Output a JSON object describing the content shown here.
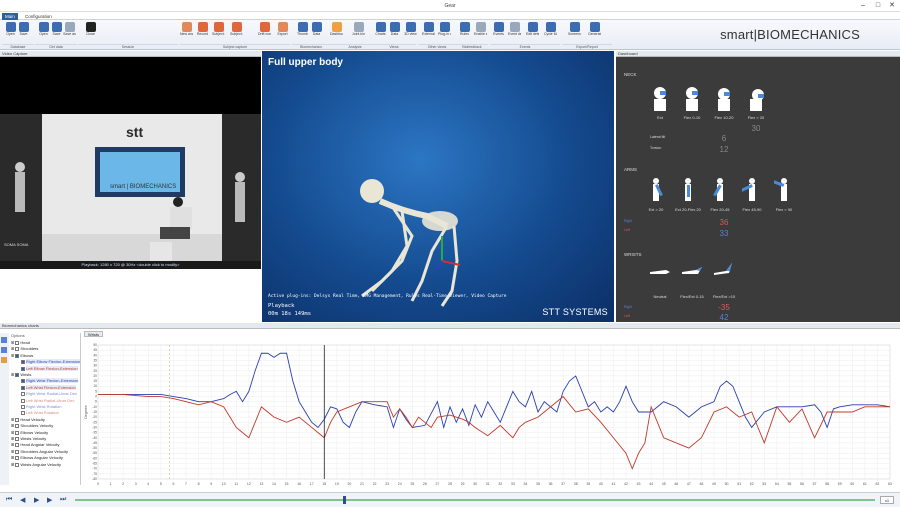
{
  "window": {
    "title": "Gear",
    "controls": [
      "–",
      "□",
      "✕"
    ]
  },
  "tabs": [
    {
      "label": "Main",
      "active": true
    },
    {
      "label": "Configuration",
      "active": false
    }
  ],
  "ribbon": {
    "buttons": [
      {
        "label": "Open",
        "icon": "folder-icon",
        "color": "#3b6db0"
      },
      {
        "label": "Save",
        "icon": "save-icon",
        "color": "#3b6db0"
      },
      {
        "label": "Open",
        "icon": "open-file-icon",
        "color": "#3b6db0"
      },
      {
        "label": "Save",
        "icon": "save-file-icon",
        "color": "#3b6db0"
      },
      {
        "label": "Save as",
        "icon": "save-as-icon",
        "color": "#9aa8bb"
      },
      {
        "label": "Close",
        "icon": "close-icon",
        "color": "#222222"
      },
      {
        "label": "New analysis",
        "icon": "new-analysis-icon",
        "color": "#e08a5c"
      },
      {
        "label": "Record",
        "icon": "record-icon",
        "color": "#e0673c"
      },
      {
        "label": "Subject on (standard)",
        "icon": "subject-standard-icon",
        "color": "#e0673c"
      },
      {
        "label": "Subject on ground (alt)",
        "icon": "subject-ground-icon",
        "color": "#e0673c"
      },
      {
        "label": "Drift correction",
        "icon": "drift-icon",
        "color": "#e0673c"
      },
      {
        "label": "Export",
        "icon": "export-icon",
        "color": "#e08a5c"
      },
      {
        "label": "Thumb",
        "icon": "thumb-icon",
        "color": "#3b6db0"
      },
      {
        "label": "Data",
        "icon": "data-icon",
        "color": "#3b6db0"
      },
      {
        "label": "Dashboard",
        "icon": "dashboard-icon",
        "color": "#f0a040"
      },
      {
        "label": "Joint kinematics",
        "icon": "joint-icon",
        "color": "#9aa8bb"
      },
      {
        "label": "Charts",
        "icon": "charts-icon",
        "color": "#3b6db0"
      },
      {
        "label": "Data",
        "icon": "data-grid-icon",
        "color": "#3b6db0"
      },
      {
        "label": "3D view",
        "icon": "3d-icon",
        "color": "#3b6db0"
      },
      {
        "label": "External devices",
        "icon": "external-devices-icon",
        "color": "#3b6db0"
      },
      {
        "label": "Plug-in views",
        "icon": "plugin-icon",
        "color": "#3b6db0"
      },
      {
        "label": "Rules",
        "icon": "rules-icon",
        "color": "#3b6db0"
      },
      {
        "label": "Enable events",
        "icon": "events-icon",
        "color": "#9aa8bb"
      },
      {
        "label": "Events",
        "icon": "events-list-icon",
        "color": "#3b6db0"
      },
      {
        "label": "Event definitions",
        "icon": "event-def-icon",
        "color": "#9aa8bb"
      },
      {
        "label": "Edit detection",
        "icon": "edit-detection-icon",
        "color": "#3b6db0"
      },
      {
        "label": "Cycle Manager",
        "icon": "cycle-icon",
        "color": "#3b6db0"
      },
      {
        "label": "Screenshots",
        "icon": "screenshot-icon",
        "color": "#3b6db0"
      },
      {
        "label": "Generate report",
        "icon": "report-icon",
        "color": "#3b6db0"
      }
    ],
    "groups": [
      "Database",
      "Get data",
      "Session",
      "Subject capture",
      "Biomechanics",
      "Analysis",
      "Views",
      "Other views",
      "Biofeedback",
      "Events",
      "Export/Report"
    ]
  },
  "brand": "smart|BIOMECHANICS",
  "video_panel": {
    "header": "Video Capture",
    "playback": "Playback: 1280 x 720 @ 30Hz <double click to modify>",
    "stt_text": "stt",
    "stt_sub": "smart | BIOMECHANICS",
    "side_text": "SOMA SOMA"
  },
  "view3d": {
    "title": "Full upper body",
    "plugins": "Active plug-ins: Delsys Real Time, EMG Management, Rules Real-Time Viewer, Video Capture",
    "mode": "Playback",
    "time": "00m 18s 149ms",
    "brand": "STT SYSTEMS"
  },
  "dashboard": {
    "header": "Dashboard",
    "neck": {
      "title": "NECK",
      "figures": [
        "Ext",
        "Flex 0-10",
        "Flex 10-20",
        "Flex > 20"
      ],
      "lateral_tilt": {
        "label": "Lateral tilt",
        "value": "6"
      },
      "torsion": {
        "label": "Torsion",
        "value": "12"
      },
      "value": "30"
    },
    "arms": {
      "title": "ARMS",
      "figures": [
        "Ext > 20",
        "Ext 20-Flex 20",
        "Flex 20-45",
        "Flex 45-90",
        "Flex > 90"
      ],
      "left": {
        "label": "Left",
        "value": "36",
        "color": "#d65a5a"
      },
      "right": {
        "label": "Right",
        "value": "33",
        "color": "#5a7fd6"
      }
    },
    "wrists": {
      "title": "WRISTS",
      "figures": [
        "Neutral",
        "Flex/Ext 0-15",
        "Flex/Ext >15"
      ],
      "left": {
        "label": "Left",
        "value": "-35",
        "color": "#d65a5a"
      },
      "right": {
        "label": "Right",
        "value": "42",
        "color": "#5a7fd6"
      }
    }
  },
  "chart_panel": {
    "header": "Biomechanics charts",
    "tab": "Wrists",
    "tree_header": "Options",
    "tree": [
      {
        "label": "Head",
        "checked": false,
        "indent": 0
      },
      {
        "label": "Shoulders",
        "checked": false,
        "indent": 0
      },
      {
        "label": "Elbows",
        "checked": true,
        "indent": 0
      },
      {
        "label": "Right Elbow Flexion-Extension",
        "checked": true,
        "indent": 1,
        "color": "#2a3fae"
      },
      {
        "label": "Left Elbow Flexion-Extension",
        "checked": true,
        "indent": 1,
        "color": "#c0392b"
      },
      {
        "label": "Wrists",
        "checked": true,
        "indent": 0
      },
      {
        "label": "Right Wrist Flexion-Extension",
        "checked": true,
        "indent": 1,
        "color": "#2a3fae"
      },
      {
        "label": "Left Wrist Flexion-Extension",
        "checked": true,
        "indent": 1,
        "color": "#c0392b"
      },
      {
        "label": "Right Wrist Radial-Ulnar Dev",
        "checked": false,
        "indent": 1,
        "color": "#7a90d6"
      },
      {
        "label": "Left Wrist Radial-Ulnar Dev",
        "checked": false,
        "indent": 1,
        "color": "#d68a7a"
      },
      {
        "label": "Right Wrist Rotation",
        "checked": false,
        "indent": 1,
        "color": "#7a90d6"
      },
      {
        "label": "Left Wrist Rotation",
        "checked": false,
        "indent": 1,
        "color": "#d68a7a"
      },
      {
        "label": "Head Velocity",
        "checked": false,
        "indent": 0
      },
      {
        "label": "Shoulders Velocity",
        "checked": false,
        "indent": 0
      },
      {
        "label": "Elbows Velocity",
        "checked": false,
        "indent": 0
      },
      {
        "label": "Wrists Velocity",
        "checked": false,
        "indent": 0
      },
      {
        "label": "Head Angular Velocity",
        "checked": false,
        "indent": 0
      },
      {
        "label": "Shoulders Angular Velocity",
        "checked": false,
        "indent": 0
      },
      {
        "label": "Elbows Angular Velocity",
        "checked": false,
        "indent": 0
      },
      {
        "label": "Wrists Angular Velocity",
        "checked": false,
        "indent": 0
      }
    ],
    "zoom": "x1"
  },
  "chart_data": {
    "type": "line",
    "ylabel": "Degrees",
    "xlim": [
      0,
      63
    ],
    "ylim": [
      -80,
      50
    ],
    "yticks": [
      50,
      45,
      40,
      35,
      30,
      25,
      20,
      15,
      10,
      5,
      0,
      -5,
      -10,
      -15,
      -20,
      -25,
      -30,
      -35,
      -40,
      -45,
      -50,
      -55,
      -60,
      -65,
      -70,
      -75,
      -80
    ],
    "xticks": [
      0,
      1,
      2,
      3,
      4,
      5,
      6,
      7,
      8,
      9,
      10,
      11,
      12,
      13,
      14,
      15,
      16,
      17,
      18,
      19,
      20,
      21,
      22,
      23,
      24,
      25,
      26,
      27,
      28,
      29,
      30,
      31,
      32,
      33,
      34,
      35,
      36,
      37,
      38,
      39,
      40,
      41,
      42,
      43,
      44,
      45,
      46,
      47,
      48,
      49,
      50,
      51,
      52,
      53,
      54,
      55,
      56,
      57,
      58,
      59,
      60,
      61,
      62,
      63
    ],
    "cursor_x": 18,
    "marker_x": 5.7,
    "series": [
      {
        "color": "#2a3fae",
        "x": [
          0,
          2,
          4,
          5,
          6,
          7,
          8,
          9,
          10,
          10.5,
          11,
          11.5,
          12,
          12.5,
          13,
          13.5,
          14,
          14.5,
          15,
          15.5,
          16,
          16.5,
          17,
          17.5,
          18,
          18.5,
          19,
          19.5,
          20,
          20.5,
          21,
          22,
          23,
          23.5,
          24,
          24.5,
          25,
          26,
          27,
          27.5,
          28,
          28.5,
          29,
          29.5,
          30,
          30.5,
          31,
          31.5,
          32,
          32.5,
          33,
          33.5,
          34,
          34.5,
          35,
          35.5,
          36,
          36.5,
          37,
          37.5,
          38,
          38.5,
          39,
          39.5,
          40,
          40.5,
          41,
          41.5,
          42,
          42.5,
          43,
          44,
          45,
          46,
          47,
          48,
          49,
          49.5,
          50,
          50.5,
          51,
          51.5,
          52,
          53,
          54,
          55,
          56,
          57,
          57.5,
          58,
          58.5,
          59,
          60,
          61,
          62,
          63
        ],
        "y": [
          2,
          2,
          2,
          2,
          0,
          -2,
          -5,
          -5,
          -2,
          2,
          5,
          -5,
          5,
          25,
          42,
          42,
          38,
          42,
          42,
          15,
          -5,
          -15,
          -25,
          -30,
          -22,
          -10,
          -12,
          -25,
          -30,
          -15,
          -5,
          -8,
          -10,
          -30,
          -12,
          -22,
          -30,
          -28,
          -5,
          -30,
          -10,
          -25,
          -12,
          -28,
          -8,
          -20,
          -5,
          -15,
          -25,
          -10,
          5,
          -5,
          -10,
          5,
          -15,
          -5,
          -10,
          -15,
          5,
          15,
          20,
          5,
          -10,
          -5,
          -15,
          -10,
          -15,
          -5,
          10,
          -5,
          -15,
          -15,
          -5,
          -10,
          -20,
          -10,
          -5,
          10,
          15,
          10,
          -5,
          -20,
          -30,
          -15,
          -10,
          -10,
          -10,
          -8,
          -15,
          -30,
          -12,
          -10,
          -8,
          -8,
          -8,
          -10
        ]
      },
      {
        "color": "#c0392b",
        "x": [
          0,
          2,
          4,
          5,
          6,
          7,
          8,
          9,
          10,
          10.5,
          11,
          11.5,
          12,
          12.5,
          13,
          13.5,
          14,
          15,
          16,
          16.5,
          17,
          17.5,
          18,
          18.5,
          19,
          20,
          21,
          22,
          23,
          23.5,
          24,
          24.5,
          25,
          25.5,
          26,
          26.5,
          27,
          28,
          29,
          29.5,
          30,
          31,
          32,
          33,
          33.5,
          34,
          35,
          36,
          37,
          38,
          39,
          40,
          41,
          42,
          42.5,
          43,
          43.5,
          44,
          45,
          46,
          47,
          48,
          49,
          50,
          51,
          52,
          53,
          54,
          55,
          56,
          57,
          58,
          59,
          60,
          61,
          62,
          63
        ],
        "y": [
          2,
          2,
          0,
          0,
          -2,
          -5,
          -8,
          -5,
          -10,
          -20,
          -30,
          -35,
          -40,
          -25,
          -10,
          -15,
          -20,
          -25,
          -20,
          -25,
          -30,
          -35,
          -40,
          -25,
          -15,
          -10,
          -5,
          -5,
          -5,
          -20,
          -12,
          -20,
          -30,
          -20,
          -25,
          -30,
          -20,
          -18,
          -22,
          -25,
          -30,
          -38,
          -28,
          -40,
          -30,
          -25,
          -20,
          -10,
          0,
          -15,
          -12,
          -25,
          -40,
          -55,
          -70,
          -55,
          -45,
          -10,
          -40,
          -45,
          -50,
          -40,
          -15,
          -10,
          -20,
          -15,
          -45,
          -10,
          -25,
          -12,
          -40,
          -15,
          -15,
          -15,
          -10,
          -10,
          -10
        ]
      }
    ]
  }
}
